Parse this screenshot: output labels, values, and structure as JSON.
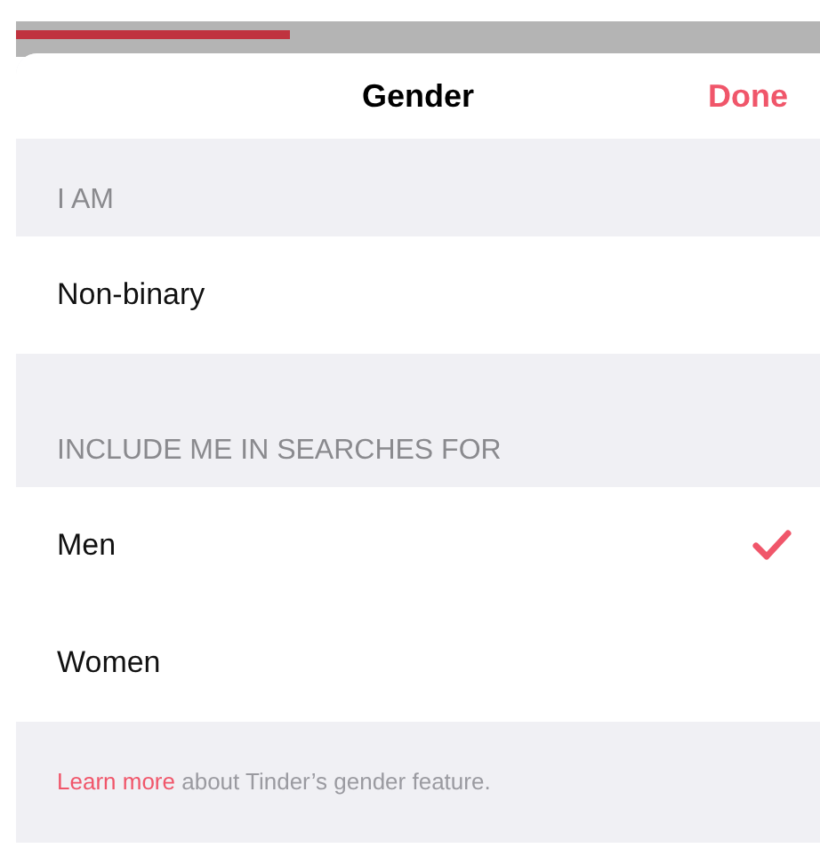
{
  "progress": {
    "level": 0.34
  },
  "header": {
    "title": "Gender",
    "done": "Done"
  },
  "sections": [
    {
      "heading": "I AM",
      "rows": [
        {
          "label": "Non-binary",
          "selected": false
        }
      ]
    },
    {
      "heading": "INCLUDE ME IN SEARCHES FOR",
      "rows": [
        {
          "label": "Men",
          "selected": true
        },
        {
          "label": "Women",
          "selected": false
        }
      ]
    }
  ],
  "footer": {
    "link": "Learn more",
    "text": "about Tinder’s gender feature."
  }
}
